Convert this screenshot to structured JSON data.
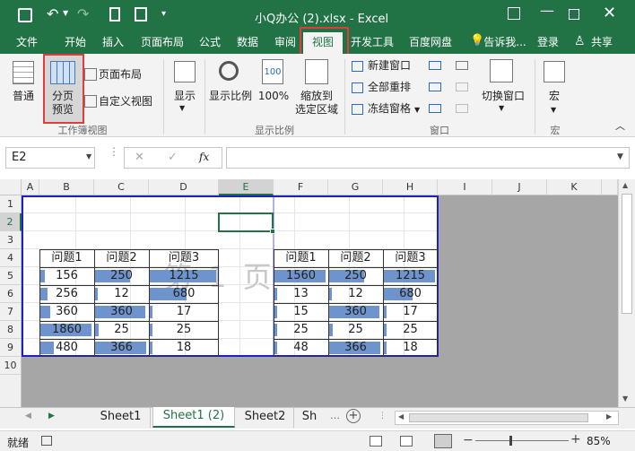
{
  "window": {
    "title": "小Q办公 (2).xlsx - Excel"
  },
  "menu_tabs": [
    "文件",
    "开始",
    "插入",
    "页面布局",
    "公式",
    "数据",
    "审阅",
    "视图",
    "开发工具",
    "百度网盘"
  ],
  "tell_me": "告诉我...",
  "login": "登录",
  "share": "共享",
  "ribbon": {
    "normal": "普通",
    "page_break_1": "分页",
    "page_break_2": "预览",
    "page_layout": "页面布局",
    "custom_views": "自定义视图",
    "workbook_views": "工作簿视图",
    "show": "显示",
    "zoom": "显示比例",
    "zoom100": "100%",
    "zoom_sel_1": "缩放到",
    "zoom_sel_2": "选定区域",
    "zoom_group": "显示比例",
    "new_window": "新建窗口",
    "arrange_all": "全部重排",
    "freeze_panes": "冻结窗格",
    "window_group": "窗口",
    "switch_windows": "切换窗口",
    "macros": "宏",
    "macros_group": "宏"
  },
  "formula_bar": {
    "name_box": "E2",
    "fx": "fx"
  },
  "columns": [
    "A",
    "B",
    "C",
    "D",
    "E",
    "F",
    "G",
    "H",
    "I",
    "J",
    "K"
  ],
  "rows": [
    "1",
    "2",
    "3",
    "4",
    "5",
    "6",
    "7",
    "8",
    "9",
    "10"
  ],
  "table_left": {
    "headers": [
      "问题1",
      "问题2",
      "问题3"
    ],
    "rows": [
      [
        "156",
        "250",
        "1215"
      ],
      [
        "256",
        "12",
        "680"
      ],
      [
        "360",
        "360",
        "17"
      ],
      [
        "1860",
        "25",
        "25"
      ],
      [
        "480",
        "366",
        "18"
      ]
    ]
  },
  "table_right": {
    "headers": [
      "问题1",
      "问题2",
      "问题3"
    ],
    "rows": [
      [
        "1560",
        "250",
        "1215"
      ],
      [
        "13",
        "12",
        "680"
      ],
      [
        "15",
        "360",
        "17"
      ],
      [
        "25",
        "25",
        "25"
      ],
      [
        "48",
        "366",
        "18"
      ]
    ]
  },
  "watermark": "第 1 页",
  "sheets": [
    "Sheet1",
    "Sheet1 (2)",
    "Sheet2",
    "Sh"
  ],
  "status": {
    "ready": "就绪",
    "zoom": "85%"
  },
  "colors": {
    "accent": "#217346",
    "databar": "#6f93cc",
    "highlight": "#e03c3c",
    "print_area": "#1f1fc8"
  }
}
